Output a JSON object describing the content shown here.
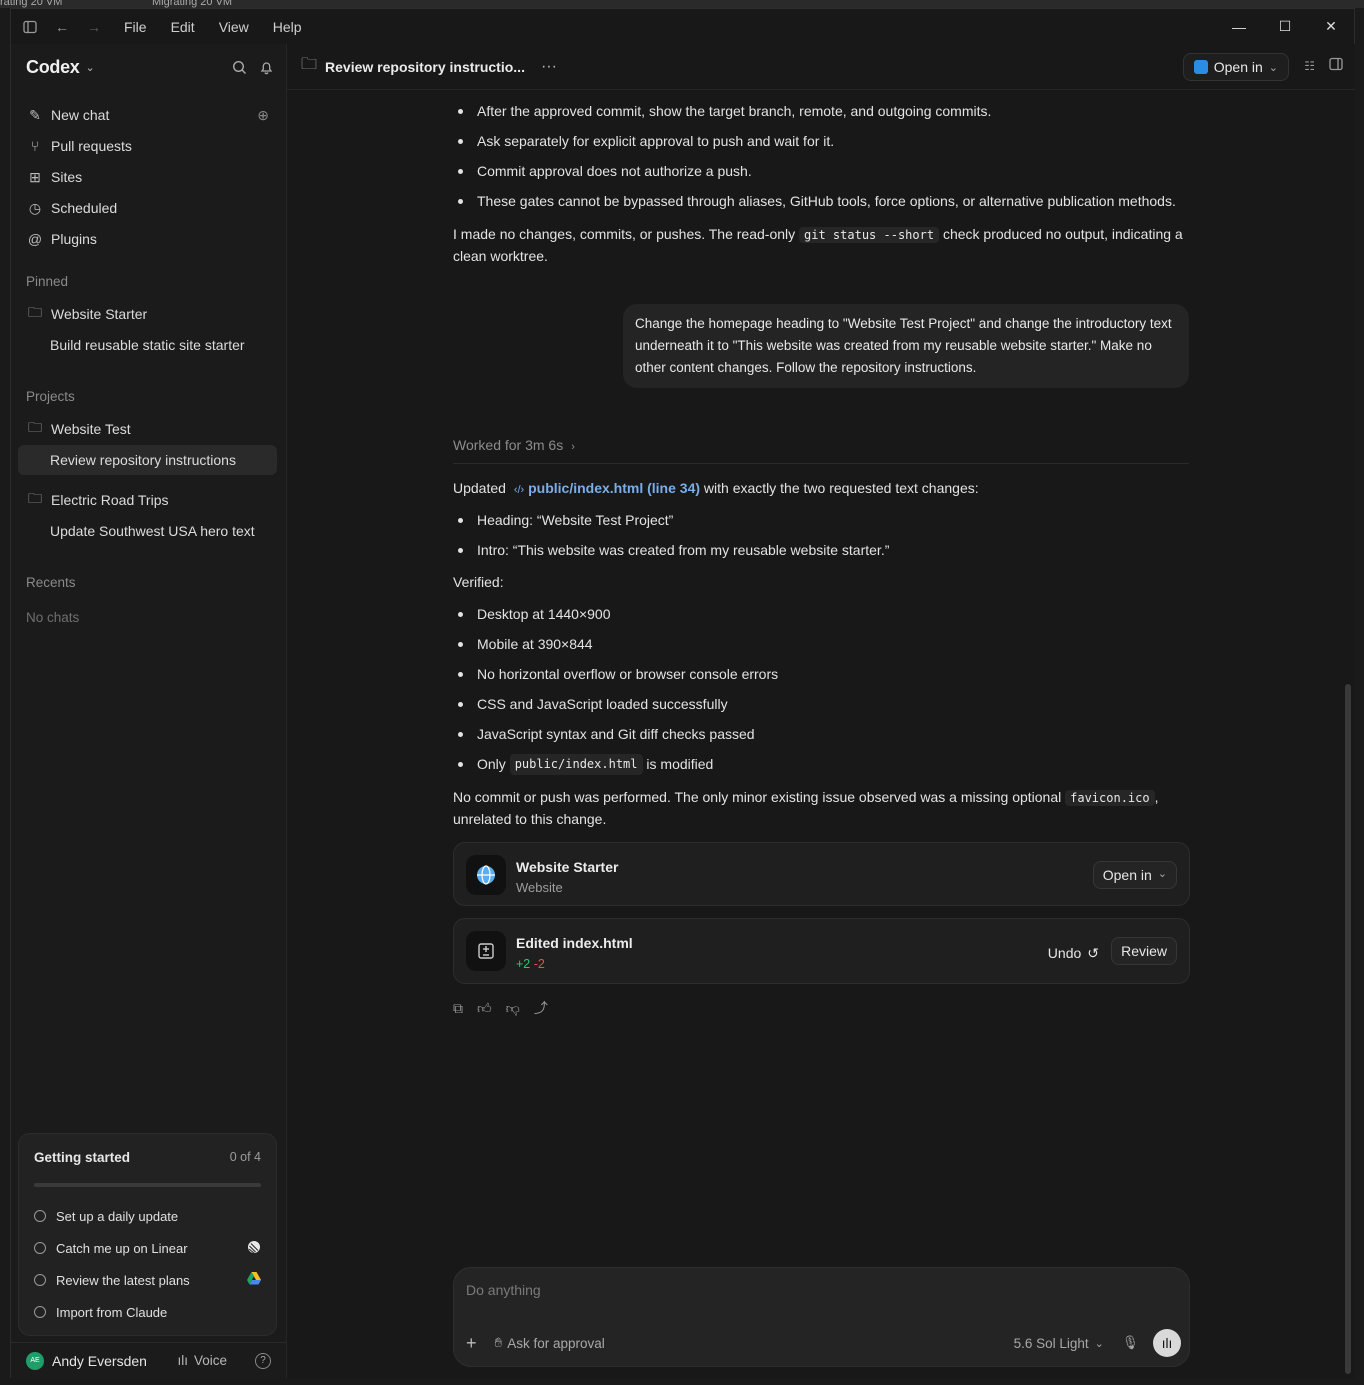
{
  "os_strip": {
    "left_text": "rating 20 VM",
    "mid_text": "Migrating 20 VM"
  },
  "menubar": {
    "items": [
      "File",
      "Edit",
      "View",
      "Help"
    ]
  },
  "sidebar": {
    "brand": "Codex",
    "nav": [
      {
        "label": "New chat",
        "icon": "compose-icon"
      },
      {
        "label": "Pull requests",
        "icon": "pull-request-icon"
      },
      {
        "label": "Sites",
        "icon": "sites-icon"
      },
      {
        "label": "Scheduled",
        "icon": "clock-icon"
      },
      {
        "label": "Plugins",
        "icon": "plugins-icon"
      }
    ],
    "pinned_label": "Pinned",
    "pinned": [
      {
        "label": "Website Starter"
      },
      {
        "label": "Build reusable static site starter"
      }
    ],
    "projects_label": "Projects",
    "projects": [
      {
        "label": "Website Test"
      },
      {
        "label": "Review repository instructions"
      },
      {
        "label": "Electric Road Trips"
      },
      {
        "label": "Update Southwest USA hero text"
      }
    ],
    "recents_label": "Recents",
    "recents_empty": "No chats",
    "getting_started": {
      "title": "Getting started",
      "count": "0 of 4",
      "progress": 0,
      "items": [
        "Set up a daily update",
        "Catch me up on Linear",
        "Review the latest plans",
        "Import from Claude"
      ]
    },
    "user": {
      "name": "Andy Eversden",
      "initials": "AE",
      "voice": "Voice"
    }
  },
  "header": {
    "title": "Review repository instructio...",
    "more": "···",
    "open_in": "Open in"
  },
  "thread": {
    "bullets_top": [
      "After the approved commit, show the target branch, remote, and outgoing commits.",
      "Ask separately for explicit approval to push and wait for it.",
      "Commit approval does not authorize a push.",
      "These gates cannot be bypassed through aliases, GitHub tools, force options, or alternative publication methods."
    ],
    "para1_a": "I made no changes, commits, or pushes. The read-only ",
    "para1_code": "git status --short",
    "para1_b": " check produced no output, indicating a clean worktree.",
    "user_message": "Change the homepage heading to \"Website Test Project\" and change the introductory text underneath it to \"This website was created from my reusable website starter.\" Make no other content changes. Follow the repository instructions.",
    "worked_for": "Worked for 3m 6s",
    "updated_a": "Updated",
    "updated_link": "public/index.html (line 34)",
    "updated_b": "with exactly the two requested text changes:",
    "changes": [
      "Heading: “Website Test Project”",
      "Intro: “This website was created from my reusable website starter.”"
    ],
    "verified_label": "Verified:",
    "verified": [
      "Desktop at 1440×900",
      "Mobile at 390×844",
      "No horizontal overflow or browser console errors",
      "CSS and JavaScript loaded successfully",
      "JavaScript syntax and Git diff checks passed"
    ],
    "only_a": "Only",
    "only_code": "public/index.html",
    "only_b": "is modified",
    "final_a": "No commit or push was performed. The only minor existing issue observed was a missing optional ",
    "final_code": "favicon.ico",
    "final_b": ", unrelated to this change.",
    "site_card": {
      "title": "Website Starter",
      "subtitle": "Website",
      "button": "Open in"
    },
    "edit_card": {
      "title": "Edited index.html",
      "added": "+2",
      "removed": "-2",
      "undo": "Undo",
      "review": "Review"
    }
  },
  "composer": {
    "placeholder": "Do anything",
    "approval": "Ask for approval",
    "model": "5.6 Sol Light"
  }
}
